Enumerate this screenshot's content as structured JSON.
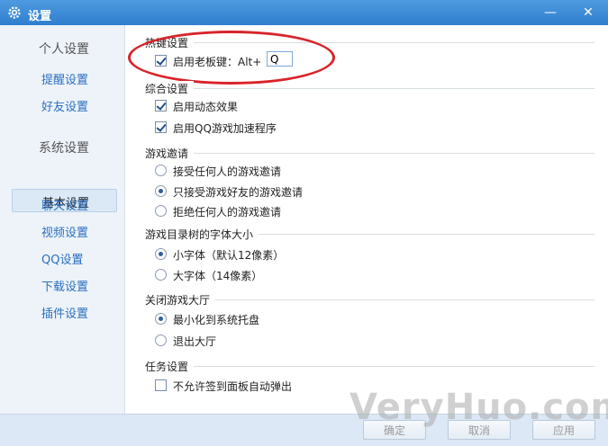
{
  "window": {
    "title": "设置",
    "minimize": "—",
    "close": "✕"
  },
  "sidebar": {
    "groups": [
      "个人设置",
      "系统设置"
    ],
    "items": [
      "提醒设置",
      "好友设置",
      "基本设置",
      "聊天设置",
      "视频设置",
      "QQ设置",
      "下载设置",
      "插件设置"
    ],
    "active": "基本设置"
  },
  "sections": {
    "hotkey": {
      "title": "热键设置",
      "opt1": "启用老板键：Alt+",
      "key_value": "Q"
    },
    "general": {
      "title": "综合设置",
      "opt1": "启用动态效果",
      "opt2": "启用QQ游戏加速程序"
    },
    "invite": {
      "title": "游戏邀请",
      "opt1": "接受任何人的游戏邀请",
      "opt2": "只接受游戏好友的游戏邀请",
      "opt3": "拒绝任何人的游戏邀请"
    },
    "font": {
      "title": "游戏目录树的字体大小",
      "opt1": "小字体（默认12像素）",
      "opt2": "大字体（14像素）"
    },
    "close": {
      "title": "关闭游戏大厅",
      "opt1": "最小化到系统托盘",
      "opt2": "退出大厅"
    },
    "task": {
      "title": "任务设置",
      "opt1": "不允许签到面板自动弹出"
    }
  },
  "footer": {
    "ok": "确定",
    "cancel": "取消",
    "apply": "应用"
  },
  "watermark": "VeryHuo.com",
  "colors": {
    "titlebar": "#3a8ad8",
    "link": "#2a6fc0",
    "highlight_ellipse": "#d8242a"
  }
}
